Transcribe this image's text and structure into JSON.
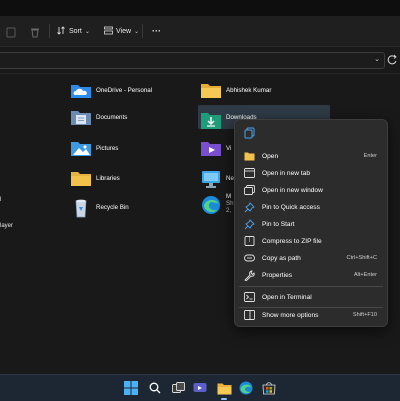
{
  "toolbar": {
    "sort_label": "Sort",
    "view_label": "View",
    "more_label": "···"
  },
  "items": {
    "onedrive": "OneDrive - Personal",
    "documents": "Documents",
    "pictures": "Pictures",
    "libraries": "Libraries",
    "recycle_bin": "Recycle Bin",
    "abhishek": "Abhishek Kumar",
    "downloads": "Downloads",
    "videos_partial": "Vi",
    "network_partial": "Ne",
    "edge_partial_title": "M",
    "edge_partial_sub1": "Sh",
    "edge_partial_sub2": "2,"
  },
  "left_fragments": {
    "frag1": "l",
    "frag2": "layer"
  },
  "context_menu": {
    "items": [
      {
        "label": "Open",
        "shortcut": "Enter",
        "icon": "open-icon"
      },
      {
        "label": "Open in new tab",
        "shortcut": "",
        "icon": "new-tab-icon"
      },
      {
        "label": "Open in new window",
        "shortcut": "",
        "icon": "new-window-icon"
      },
      {
        "label": "Pin to Quick access",
        "shortcut": "",
        "icon": "pin-icon"
      },
      {
        "label": "Pin to Start",
        "shortcut": "",
        "icon": "pin-icon"
      },
      {
        "label": "Compress to ZIP file",
        "shortcut": "",
        "icon": "zip-icon"
      },
      {
        "label": "Copy as path",
        "shortcut": "Ctrl+Shift+C",
        "icon": "copy-path-icon"
      },
      {
        "label": "Properties",
        "shortcut": "Alt+Enter",
        "icon": "properties-icon"
      },
      {
        "label": "Open in Terminal",
        "shortcut": "",
        "icon": "terminal-icon"
      },
      {
        "label": "Show more options",
        "shortcut": "Shift+F10",
        "icon": "more-options-icon"
      }
    ]
  },
  "colors": {
    "folder_yellow": "#f3c24a",
    "accent_blue": "#4aa3f0",
    "selection": "#2e3a45"
  }
}
